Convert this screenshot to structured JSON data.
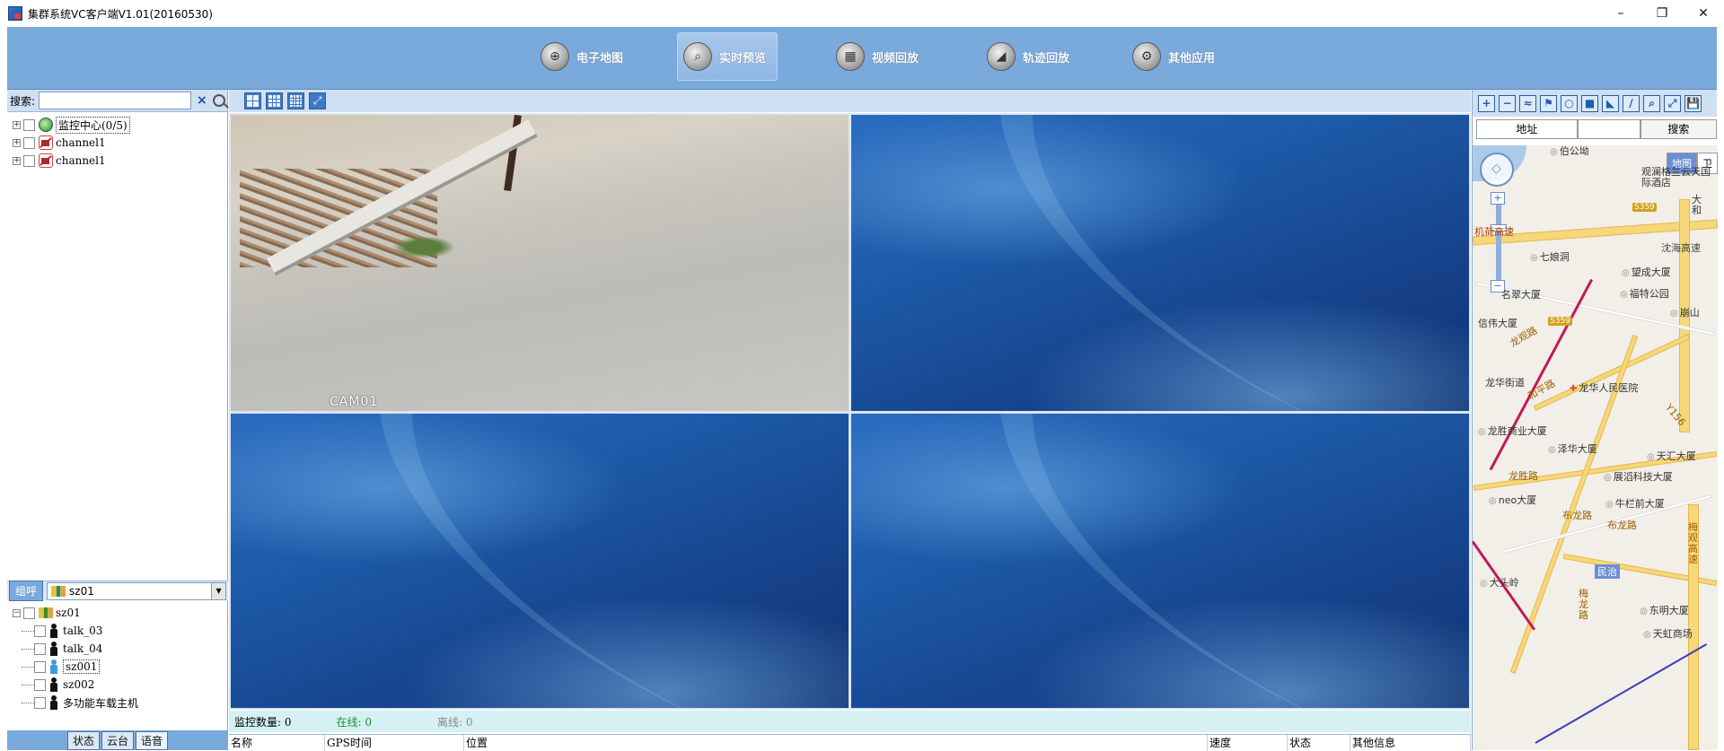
{
  "window": {
    "title": "集群系统VC客户端V1.01(20160530)",
    "controls": {
      "minimize": "–",
      "restore": "❐",
      "close": "✕"
    }
  },
  "nav": {
    "items": [
      {
        "label": "电子地图",
        "icon": "map-icon",
        "glyph": "⊕"
      },
      {
        "label": "实时预览",
        "icon": "search-icon",
        "glyph": "⌕",
        "active": true
      },
      {
        "label": "视频回放",
        "icon": "video-playback-icon",
        "glyph": "▦"
      },
      {
        "label": "轨迹回放",
        "icon": "track-playback-icon",
        "glyph": "◢"
      },
      {
        "label": "其他应用",
        "icon": "settings-icon",
        "glyph": "⚙"
      }
    ]
  },
  "left": {
    "search_label": "搜索:",
    "search_value": "",
    "clear_glyph": "×",
    "tree": [
      {
        "label": "监控中心(0/5)",
        "icon": "monitor-center-icon"
      },
      {
        "label": "channel1",
        "icon": "camera-offline-icon"
      },
      {
        "label": "channel1",
        "icon": "camera-offline-icon"
      }
    ],
    "group_button": "组呼",
    "group_selected": "sz01",
    "talk_tree": {
      "root": "sz01",
      "members": [
        {
          "label": "talk_03",
          "color": "#111111"
        },
        {
          "label": "talk_04",
          "color": "#111111"
        },
        {
          "label": "sz001",
          "color": "#3b9be0"
        },
        {
          "label": "sz002",
          "color": "#111111"
        },
        {
          "label": "多功能车载主机",
          "color": "#111111"
        }
      ]
    },
    "bottom_tabs": [
      "状态",
      "云台",
      "语音"
    ]
  },
  "video": {
    "layout_buttons": [
      "4-split",
      "9-split",
      "16-split",
      "fullscreen"
    ],
    "channels": [
      {
        "name": "CAM01",
        "type": "camera"
      },
      {
        "name": "",
        "type": "desktop"
      },
      {
        "name": "",
        "type": "desktop"
      },
      {
        "name": "",
        "type": "desktop"
      }
    ],
    "status": {
      "monitor_count": "监控数量: 0",
      "online": "在线: 0",
      "offline": "离线: 0"
    },
    "columns": [
      "名称",
      "GPS时间",
      "位置",
      "速度",
      "状态",
      "其他信息"
    ]
  },
  "map": {
    "tools": [
      "+",
      "−",
      "≈",
      "⚑",
      "○",
      "■",
      "◣",
      "∕",
      "⌕",
      "⤢",
      "💾"
    ],
    "address_label": "地址",
    "address_value": "",
    "search_button": "搜索",
    "map_types": [
      "地图",
      "卫"
    ],
    "labels": [
      "伯公坳",
      "观澜格兰云天国际酒店",
      "大和",
      "S359",
      "机荷高速",
      "沈海高速",
      "七娘洞",
      "望成大厦",
      "福特公园",
      "名翠大厦",
      "崩山",
      "信伟大厦",
      "S359",
      "龙观路",
      "龙华街道",
      "和平路",
      "龙华人民医院",
      "Y156",
      "龙胜商业大厦",
      "泽华大厦",
      "天汇大厦",
      "龙胜路",
      "展滔科技大厦",
      "neo大厦",
      "牛栏前大厦",
      "布龙路",
      "布龙路",
      "梅观高速",
      "民治",
      "大头岭",
      "梅龙路",
      "东明大厦",
      "天虹商场"
    ]
  }
}
